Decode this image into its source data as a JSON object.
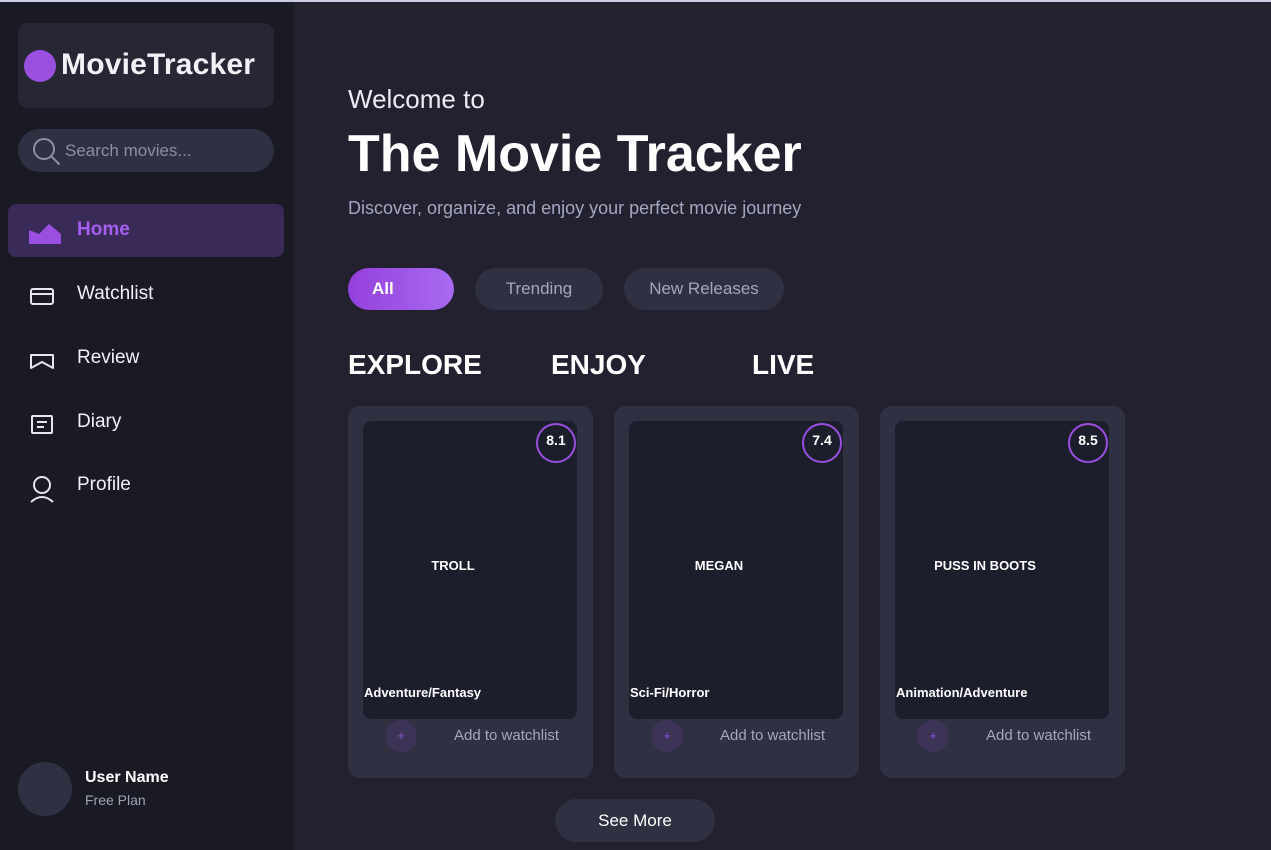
{
  "brand": {
    "name": "MovieTracker",
    "accent": "#9a4fe0"
  },
  "search": {
    "placeholder": "Search movies..."
  },
  "nav": {
    "items": [
      {
        "label": "Home",
        "icon": "home-icon",
        "active": true
      },
      {
        "label": "Watchlist",
        "icon": "watchlist-icon"
      },
      {
        "label": "Review",
        "icon": "review-icon"
      },
      {
        "label": "Diary",
        "icon": "diary-icon"
      },
      {
        "label": "Profile",
        "icon": "profile-icon"
      }
    ]
  },
  "user": {
    "name": "User Name",
    "plan": "Free Plan"
  },
  "hero": {
    "welcome": "Welcome to",
    "title": "The Movie Tracker",
    "subtitle": "Discover, organize, and enjoy your perfect movie journey"
  },
  "filters": [
    {
      "label": "All",
      "active": true
    },
    {
      "label": "Trending"
    },
    {
      "label": "New Releases"
    }
  ],
  "sections": [
    "EXPLORE",
    "ENJOY",
    "LIVE"
  ],
  "movies": [
    {
      "title": "TROLL",
      "genre": "Adventure/Fantasy",
      "rating": "8.1",
      "add_icon": "+",
      "add_label": "Add to watchlist"
    },
    {
      "title": "MEGAN",
      "genre": "Sci-Fi/Horror",
      "rating": "7.4",
      "add_icon": "+",
      "add_label": "Add to watchlist"
    },
    {
      "title": "PUSS IN BOOTS",
      "genre": "Animation/Adventure",
      "rating": "8.5",
      "add_icon": "+",
      "add_label": "Add to watchlist"
    }
  ],
  "see_more": "See More"
}
